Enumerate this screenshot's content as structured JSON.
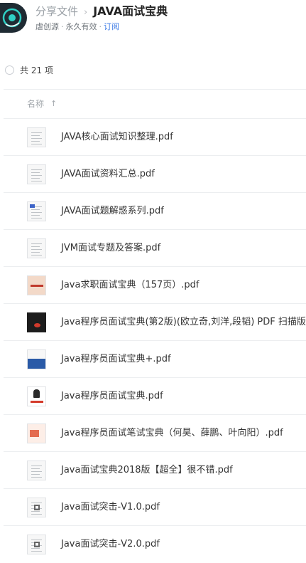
{
  "header": {
    "parent_label": "分享文件",
    "separator": "›",
    "title": "JAVA面试宝典",
    "owner": "虐创源",
    "dot": "·",
    "validity": "永久有效",
    "dot2": "·",
    "subscribe": "订阅"
  },
  "list": {
    "count_label": "共 21 项",
    "column_name": "名称",
    "sort_icon": "↑"
  },
  "files": [
    {
      "name": "JAVA核心面试知识整理.pdf",
      "thumb": "doc"
    },
    {
      "name": "JAVA面试资料汇总.pdf",
      "thumb": "doc"
    },
    {
      "name": "JAVA面试题解惑系列.pdf",
      "thumb": "doc-blue"
    },
    {
      "name": "JVM面试专题及答案.pdf",
      "thumb": "doc"
    },
    {
      "name": "Java求职面试宝典（157页）.pdf",
      "thumb": "cover-pink"
    },
    {
      "name": "Java程序员面试宝典(第2版)(欧立奇,刘洋,段韬) PDF 扫描版",
      "thumb": "cover-dark"
    },
    {
      "name": "Java程序员面试宝典+.pdf",
      "thumb": "cover-blue"
    },
    {
      "name": "Java程序员面试宝典.pdf",
      "thumb": "cover-white"
    },
    {
      "name": "Java程序员面试笔试宝典（何昊、薛鹏、叶向阳）.pdf",
      "thumb": "cover-peach"
    },
    {
      "name": "Java面试宝典2018版【超全】很不错.pdf",
      "thumb": "doc"
    },
    {
      "name": "Java面试突击-V1.0.pdf",
      "thumb": "doc-qr"
    },
    {
      "name": "Java面试突击-V2.0.pdf",
      "thumb": "doc-qr"
    }
  ]
}
